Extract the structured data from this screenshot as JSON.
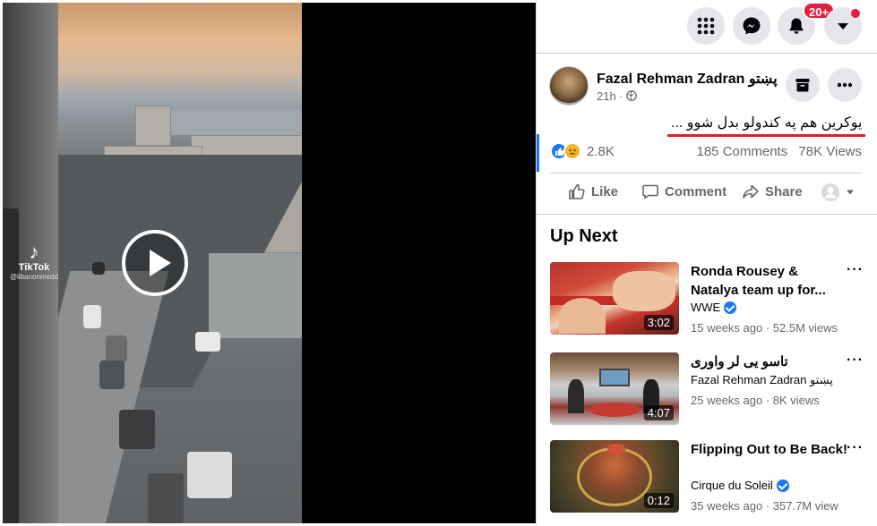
{
  "video": {
    "watermark_logo": "♪",
    "watermark_name": "TikTok",
    "watermark_user": "@libanonmedd"
  },
  "nav": {
    "notification_badge": "20+"
  },
  "post": {
    "author": "Fazal Rehman Zadran پښتو",
    "time": "21h · ",
    "text": "یوکرین هم په کندولو بدل شوو ...",
    "reaction_count": "2.8K",
    "comments": "185 Comments",
    "views": "78K Views",
    "actions": {
      "like": "Like",
      "comment": "Comment",
      "share": "Share"
    }
  },
  "up_next": {
    "heading": "Up Next",
    "items": [
      {
        "title": "Ronda Rousey & Natalya team up for...",
        "channel": "WWE",
        "verified": true,
        "meta": "15 weeks ago · 52.5M views",
        "duration": "3:02"
      },
      {
        "title": "تاسو یی لر واوری",
        "channel": "Fazal Rehman Zadran پښتو",
        "verified": false,
        "meta": "25 weeks ago · 8K views",
        "duration": "4:07"
      },
      {
        "title": "Flipping Out to Be Back!",
        "channel": "Cirque du Soleil",
        "verified": true,
        "meta": "35 weeks ago · 357.7M view",
        "duration": "0:12"
      }
    ]
  },
  "colors": {
    "facebook_blue": "#1877f2",
    "badge_red": "#e41e3f",
    "underline_red": "#d9222a"
  }
}
